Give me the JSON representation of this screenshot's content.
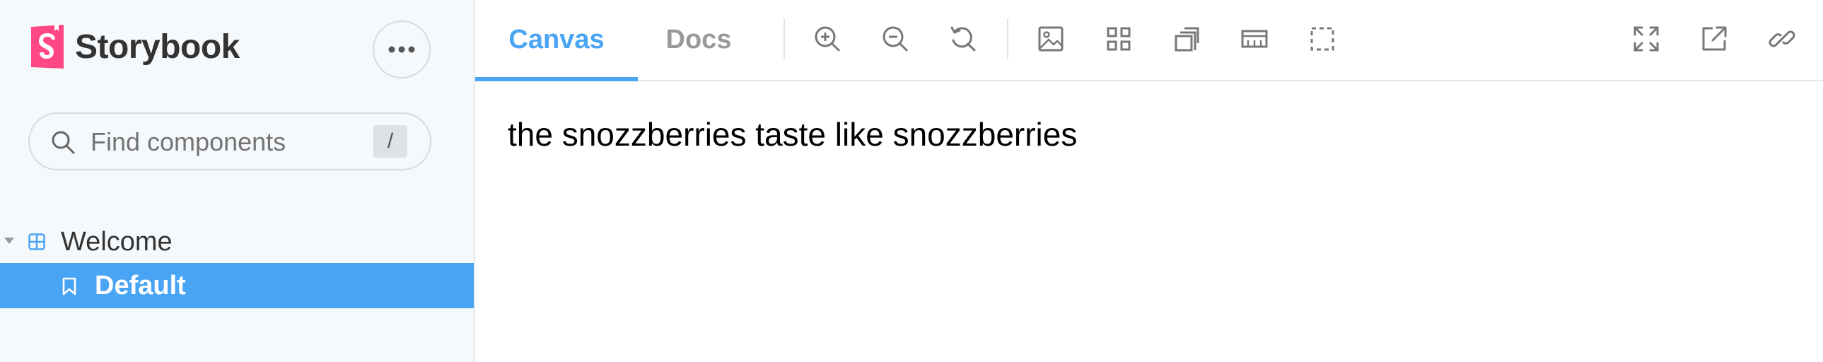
{
  "app": {
    "brand_name": "Storybook",
    "brand_color": "#FF4785"
  },
  "search": {
    "placeholder": "Find components",
    "shortcut_key": "/"
  },
  "sidebar": {
    "groups": [
      {
        "label": "Welcome",
        "icon": "component-icon",
        "expanded": true,
        "items": [
          {
            "label": "Default",
            "icon": "bookmark-icon",
            "selected": true
          }
        ]
      }
    ]
  },
  "toolbar": {
    "tabs": [
      {
        "label": "Canvas",
        "active": true
      },
      {
        "label": "Docs",
        "active": false
      }
    ],
    "tools": [
      "zoom-in-icon",
      "zoom-out-icon",
      "zoom-reset-icon",
      "background-icon",
      "grid-icon",
      "outline-icon",
      "measure-icon",
      "viewport-icon"
    ],
    "right_tools": [
      "fullscreen-icon",
      "open-new-tab-icon",
      "copy-link-icon"
    ]
  },
  "canvas": {
    "story_text": "the snozzberries taste like snozzberries"
  },
  "colors": {
    "accent": "#4AA4F4",
    "sidebar_bg": "#F6F9FC",
    "selected_bg": "#4AA4F4"
  }
}
